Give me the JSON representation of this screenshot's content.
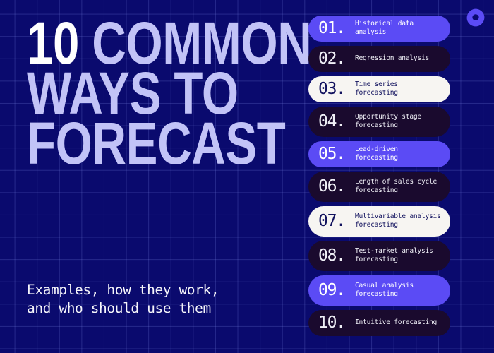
{
  "poster": {
    "background_color": "#0A0A6E",
    "grid_line_color": "#7882E1",
    "accent_color": "#5B4BF5",
    "dark_chip_color": "#1A0A2E",
    "light_chip_color": "#F7F5F2",
    "headline_color": "#C2C3F7",
    "number_color": "#FFFFFF"
  },
  "logo": {
    "name": "brand-blob-logo",
    "color": "#5B4BF5"
  },
  "headline": {
    "line1_number": "10",
    "line1_rest": "COMMON",
    "line2": "WAYS TO",
    "line3": "FORECAST"
  },
  "subtitle": {
    "text": "Examples, how they work,\nand who should use them"
  },
  "list": {
    "items": [
      {
        "number": "01.",
        "label": "Historical data analysis",
        "theme": "accent",
        "lines": 1
      },
      {
        "number": "02.",
        "label": "Regression analysis",
        "theme": "dark",
        "lines": 1
      },
      {
        "number": "03.",
        "label": "Time series forecasting",
        "theme": "light",
        "lines": 1
      },
      {
        "number": "04.",
        "label": "Opportunity stage\nforecasting",
        "theme": "dark",
        "lines": 2
      },
      {
        "number": "05.",
        "label": "Lead-driven forecasting",
        "theme": "accent",
        "lines": 1
      },
      {
        "number": "06.",
        "label": "Length of sales cycle\nforecasting",
        "theme": "dark",
        "lines": 2
      },
      {
        "number": "07.",
        "label": "Multivariable analysis\nforecasting",
        "theme": "light",
        "lines": 2
      },
      {
        "number": "08.",
        "label": "Test-market analysis\nforecasting",
        "theme": "dark",
        "lines": 2
      },
      {
        "number": "09.",
        "label": "Casual analysis\nforecasting",
        "theme": "accent",
        "lines": 2
      },
      {
        "number": "10.",
        "label": "Intuitive forecasting",
        "theme": "dark",
        "lines": 1
      }
    ]
  }
}
